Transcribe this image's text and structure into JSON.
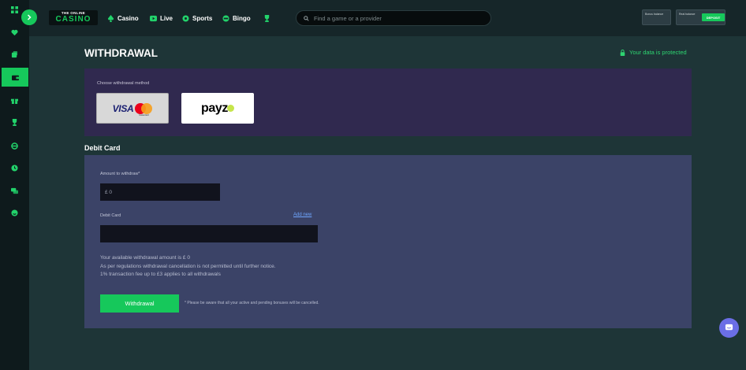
{
  "header": {
    "logo_line1": "THE ONLINE",
    "logo_line2": "CASINO",
    "nav": [
      {
        "label": "Casino",
        "icon": "spades-icon"
      },
      {
        "label": "Live",
        "icon": "live-icon"
      },
      {
        "label": "Sports",
        "icon": "ball-icon"
      },
      {
        "label": "Bingo",
        "icon": "bingo-icon"
      },
      {
        "label": "",
        "icon": "trophy-icon"
      }
    ],
    "search_placeholder": "Find a game or a provider",
    "bonus_balance_label": "Bonus balance",
    "real_balance_label": "Real balance",
    "deposit_label": "DEPOSIT"
  },
  "sidebar": {
    "icons": [
      "grid-icon",
      "heart-icon",
      "dice-icon",
      "wallet-icon",
      "gift-icon",
      "trophy-icon",
      "globe-icon",
      "clock-icon",
      "chat-icon",
      "support-icon"
    ],
    "active_index": 3
  },
  "page": {
    "title": "WITHDRAWAL",
    "protected_text": "Your data is protected",
    "method_label": "Choose withdrawal method",
    "methods": [
      {
        "name": "VISA",
        "sub": "mastercard"
      },
      {
        "name": "payz"
      }
    ],
    "section_title": "Debit Card",
    "amount_label": "Amount to withdraw*",
    "amount_value": "£ 0",
    "card_label": "Debit Card",
    "add_new": "Add new",
    "info_lines": [
      "Your available withdrawal amount is £ 0",
      "As per regulations withdrawal cancellation is not permitted until further notice.",
      "1% transaction fee up to £3 applies to all withdrawals"
    ],
    "withdraw_button": "Withdrawal",
    "note": "* Please be aware that all your active and pending bonuses will be cancelled."
  },
  "colors": {
    "accent": "#16c85b",
    "background": "#1e3537",
    "method_panel": "#30294f",
    "form_panel": "#3b4367",
    "chat": "#6b6ee6"
  }
}
